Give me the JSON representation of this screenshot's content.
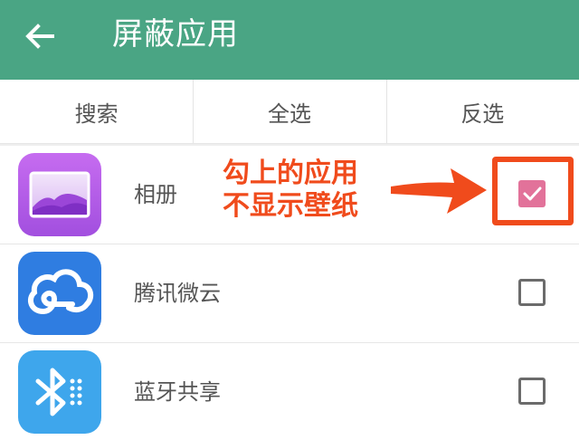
{
  "appbar": {
    "title": "屏蔽应用",
    "back_icon": "arrow-left-icon",
    "background": "#4aa584"
  },
  "actions": {
    "search": "搜索",
    "select_all": "全选",
    "invert": "反选"
  },
  "apps": [
    {
      "name": "相册",
      "icon": "gallery-icon",
      "checked": true
    },
    {
      "name": "腾讯微云",
      "icon": "cloud-icon",
      "checked": false
    },
    {
      "name": "蓝牙共享",
      "icon": "bluetooth-icon",
      "checked": false
    }
  ],
  "annotation": {
    "line1": "勾上的应用",
    "line2": "不显示壁纸",
    "color": "#f04b1c"
  },
  "colors": {
    "checked_box": "#e2729a",
    "gallery_icon": "#b85ee6",
    "cloud_icon": "#2f7de1",
    "bluetooth_icon": "#3ea6ec"
  }
}
